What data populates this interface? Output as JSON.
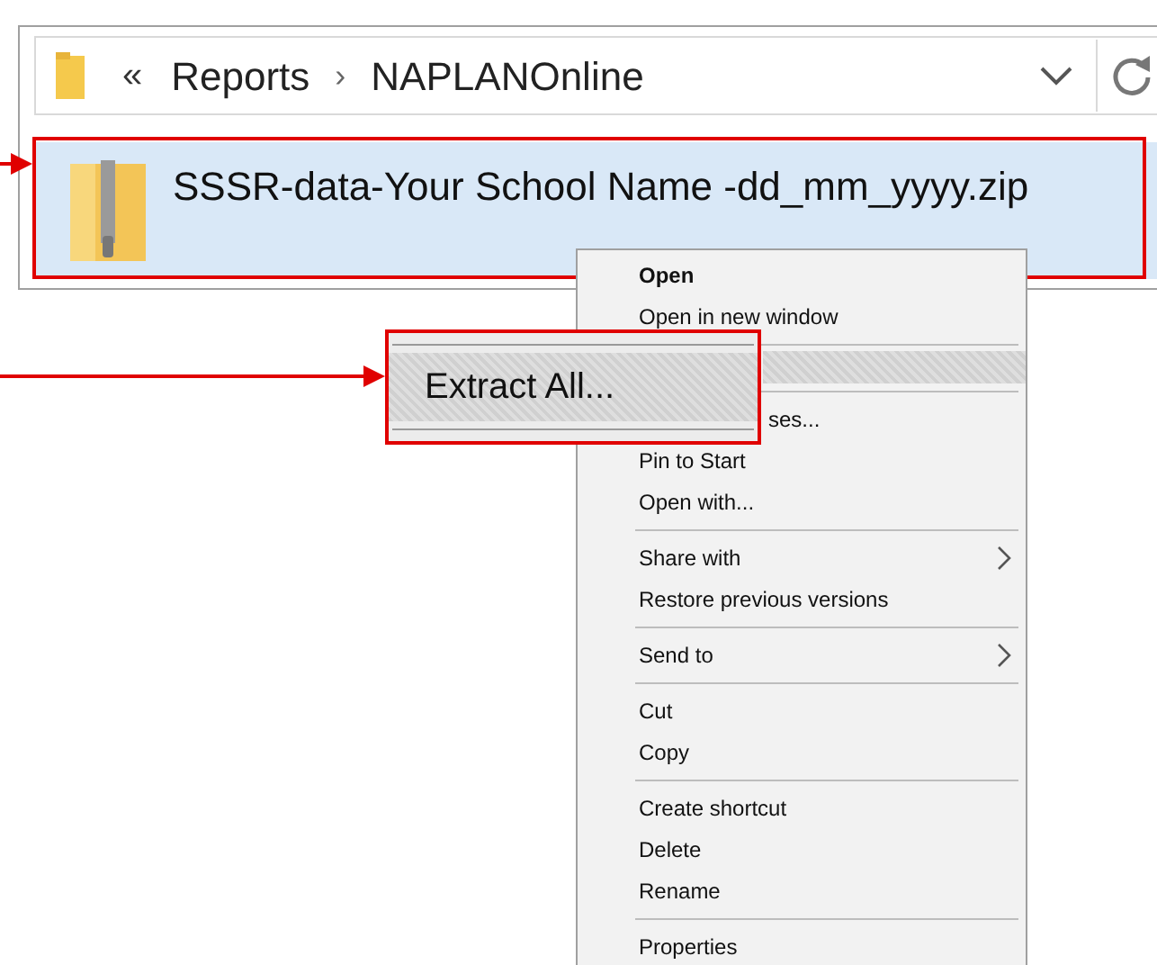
{
  "address_bar": {
    "overflow": "«",
    "separator": "›",
    "path": [
      "Reports",
      "NAPLANOnline"
    ]
  },
  "file": {
    "name": "SSSR-data-Your School Name -dd_mm_yyyy.zip",
    "selected": true
  },
  "context_menu": {
    "items": [
      {
        "kind": "item",
        "label": "Open",
        "default": true,
        "submenu": false
      },
      {
        "kind": "item",
        "label": "Open in new window",
        "default": false,
        "submenu": false
      },
      {
        "kind": "separator"
      },
      {
        "kind": "highlight"
      },
      {
        "kind": "separator"
      },
      {
        "kind": "item",
        "label": "ses...",
        "default": false,
        "submenu": false,
        "covered": true
      },
      {
        "kind": "item",
        "label": "Pin to Start",
        "default": false,
        "submenu": false
      },
      {
        "kind": "item",
        "label": "Open with...",
        "default": false,
        "submenu": false
      },
      {
        "kind": "separator"
      },
      {
        "kind": "item",
        "label": "Share with",
        "default": false,
        "submenu": true
      },
      {
        "kind": "item",
        "label": "Restore previous versions",
        "default": false,
        "submenu": false
      },
      {
        "kind": "separator"
      },
      {
        "kind": "item",
        "label": "Send to",
        "default": false,
        "submenu": true
      },
      {
        "kind": "separator"
      },
      {
        "kind": "item",
        "label": "Cut",
        "default": false,
        "submenu": false
      },
      {
        "kind": "item",
        "label": "Copy",
        "default": false,
        "submenu": false
      },
      {
        "kind": "separator"
      },
      {
        "kind": "item",
        "label": "Create shortcut",
        "default": false,
        "submenu": false
      },
      {
        "kind": "item",
        "label": "Delete",
        "default": false,
        "submenu": false
      },
      {
        "kind": "item",
        "label": "Rename",
        "default": false,
        "submenu": false
      },
      {
        "kind": "separator"
      },
      {
        "kind": "item",
        "label": "Properties",
        "default": false,
        "submenu": false
      }
    ]
  },
  "callout": {
    "label": "Extract All..."
  }
}
